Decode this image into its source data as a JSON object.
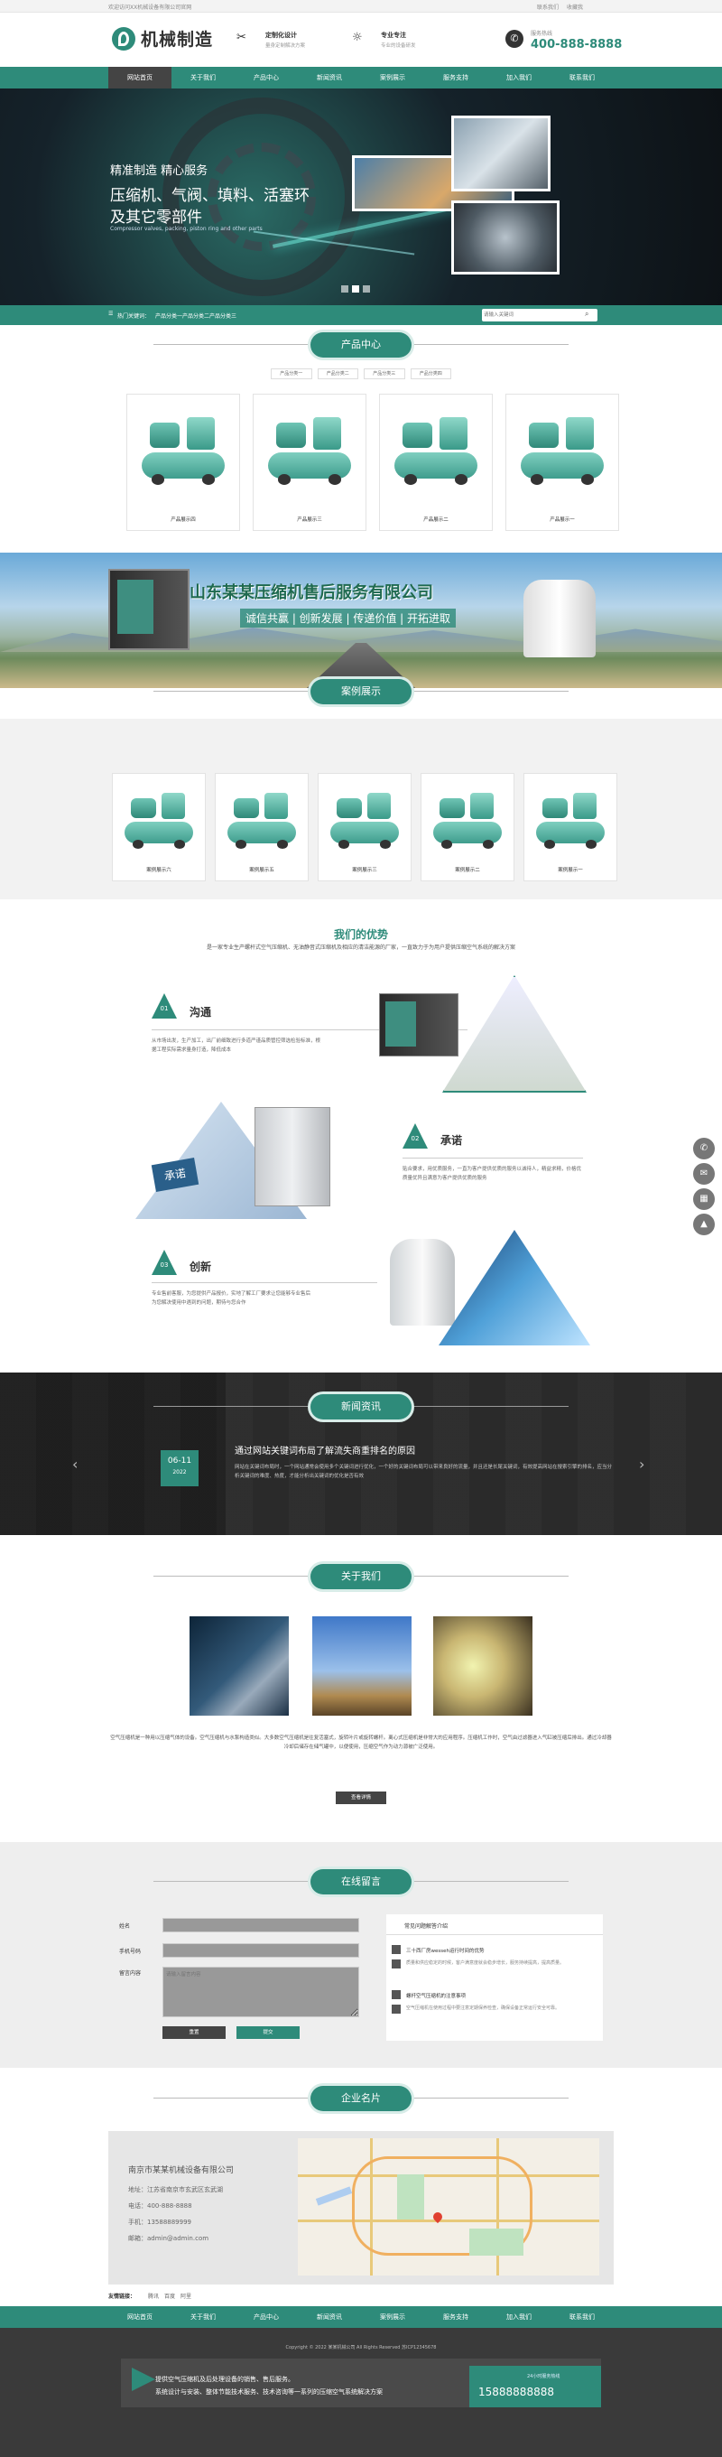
{
  "topbar": {
    "welcome": "欢迎访问XX机械设备有限公司官网",
    "links": [
      "联系我们",
      "收藏我"
    ]
  },
  "header": {
    "logo_text": "机械制造",
    "f1_title": "定制化设计",
    "f1_sub": "量身定制解决方案",
    "f2_title": "专业专注",
    "f2_sub": "专业的设备研发",
    "hotline_label": "服务热线",
    "hotline": "400-888-8888"
  },
  "nav": [
    "网站首页",
    "关于我们",
    "产品中心",
    "新闻资讯",
    "案例展示",
    "服务支持",
    "加入我们",
    "联系我们"
  ],
  "banner": {
    "line1": "精准制造 精心服务",
    "line2": "压缩机、气阀、填料、活塞环",
    "line3": "及其它零部件",
    "line4": "Compressor valves, packing, piston ring and other parts"
  },
  "hotbar": {
    "label": "热门关键词：",
    "links": [
      "产品分类一",
      "产品分类二",
      "产品分类三"
    ],
    "search_placeholder": "请输入关键词"
  },
  "products": {
    "title": "产品中心",
    "tabs": [
      "产品分类一",
      "产品分类二",
      "产品分类三",
      "产品分类四"
    ],
    "items": [
      "产品展示四",
      "产品展示三",
      "产品展示二",
      "产品展示一"
    ]
  },
  "ad": {
    "title": "山东某某压缩机售后服务有限公司",
    "slogan": "诚信共赢 | 创新发展 | 传递价值 | 开拓进取"
  },
  "cases": {
    "title": "案例展示",
    "items": [
      "案例展示六",
      "案例展示五",
      "案例展示三",
      "案例展示二",
      "案例展示一"
    ]
  },
  "adv": {
    "title": "我们的优势",
    "sub": "是一家专业生产螺杆式空气压缩机、无油静音式压缩机及相应的清洁能源的厂家，一直致力于为用户提供压缩空气系统的解决方案",
    "items": [
      {
        "num": "01",
        "name": "沟通",
        "text": "从市场出发，生产加工，出厂前细致进行多道严谨品质管控筛选检验标准，根据工程实际需求量身打造，降低成本"
      },
      {
        "num": "02",
        "name": "承诺",
        "text": "贴合要求，用优质服务，一直为客户提供优质的服务以诚待人，精益求精，价格优质量优异且满意为客户提供优质的服务"
      },
      {
        "num": "03",
        "name": "创新",
        "text": "专业售前客服，为您提供产品报价，实地了解工厂要求让您能够专业售后为您解决使用中遇到的问题，期待与您合作"
      }
    ],
    "puzzle_text": "承诺"
  },
  "news": {
    "title": "新闻资讯",
    "day": "06-11",
    "year": "2022",
    "headline": "通过网站关键词布局了解流失商重排名的原因",
    "summary": "网站在关键词布局时，一个网站通常会使用多个关键词进行优化，一个好的关键词布局可以带来良好的流量，并且还是长尾关键词，有效提高网站在搜索引擎的排名，应当分析关键词的难度、热度，才能分析出关键词的优化是否有效"
  },
  "about": {
    "title": "关于我们",
    "text": "空气压缩机是一种用以压缩气体的设备。空气压缩机与水泵构造类似。大多数空气压缩机是往复活塞式，旋转叶片或旋转螺杆。离心式压缩机是非常大的应用程序。压缩机工作时，空气由过滤器进入气缸被压缩后排出。通过冷却器冷却后储存在储气罐中，以便使用，压缩空气作为动力源被广泛使用。",
    "more": "查看详情"
  },
  "msg": {
    "title": "在线留言",
    "labels": [
      "姓名",
      "手机号码",
      "留言内容"
    ],
    "placeholder": "请输入留言内容",
    "reset": "重置",
    "submit": "提交",
    "faq_title": "常见问题解答介绍",
    "faqs": [
      {
        "q": "三十西厂房wesseh运行时间的优势",
        "a": "质量和供应稳定的时候，客户满意度就会稳步增长，服务持续提高，提高质量。"
      },
      {
        "q": "螺杆空气压缩机的注意事项",
        "a": "空气压缩机在使用过程中要注意定期保养检查，确保设备正常运行安全可靠。"
      }
    ]
  },
  "card": {
    "title": "企业名片",
    "company": "南京市某某机械设备有限公司",
    "rows": [
      "地址：江苏省南京市玄武区玄武湖",
      "电话：400-888-8888",
      "手机：13588889999",
      "邮箱：admin@admin.com"
    ]
  },
  "links": {
    "label": "友情链接：",
    "items": [
      "腾讯",
      "百度",
      "阿里"
    ]
  },
  "footer": {
    "copyright": "Copyright © 2022 某某机械公司 All Rights Reserved 苏ICP12345678",
    "cta1": "提供空气压缩机及后处理设备的销售、售后服务。",
    "cta2": "系统设计与安装、整体节能技术服务、技术咨询等一系列的压缩空气系统解决方案",
    "phone_label": "24小时服务热线",
    "phone": "15888888888"
  },
  "colors": {
    "accent": "#2e8b7a",
    "dark": "#333333"
  },
  "side_icons": [
    "phone-icon",
    "chat-icon",
    "qrcode-icon",
    "top-icon"
  ]
}
